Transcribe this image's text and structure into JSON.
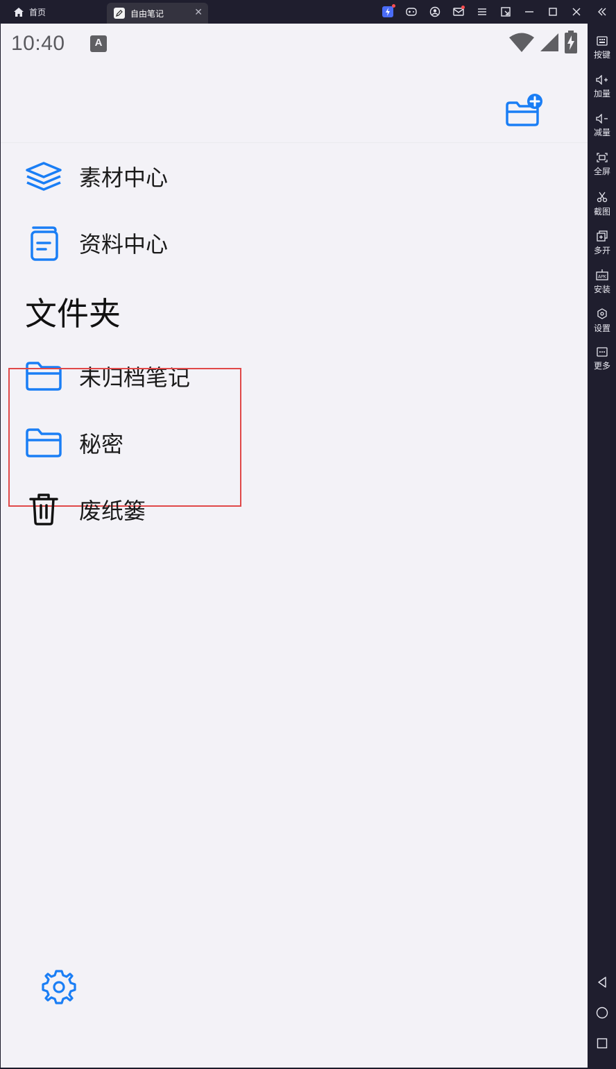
{
  "emulator": {
    "home_tab_label": "首页",
    "app_tab_label": "自由笔记",
    "sidebar": [
      {
        "label": "按键",
        "icon": "keyboard-icon"
      },
      {
        "label": "加量",
        "icon": "volume-up-icon"
      },
      {
        "label": "减量",
        "icon": "volume-down-icon"
      },
      {
        "label": "全屏",
        "icon": "fullscreen-icon"
      },
      {
        "label": "截图",
        "icon": "scissors-icon"
      },
      {
        "label": "多开",
        "icon": "multi-instance-icon"
      },
      {
        "label": "安装",
        "icon": "apk-install-icon"
      },
      {
        "label": "设置",
        "icon": "settings-hex-icon"
      },
      {
        "label": "更多",
        "icon": "more-icon"
      }
    ]
  },
  "status_bar": {
    "time": "10:40",
    "indicator": "A"
  },
  "menu": {
    "items": [
      {
        "label": "素材中心",
        "icon": "layers-icon"
      },
      {
        "label": "资料中心",
        "icon": "document-icon"
      }
    ],
    "folders_title": "文件夹",
    "folders": [
      {
        "label": "未归档笔记",
        "icon": "folder-icon"
      },
      {
        "label": "秘密",
        "icon": "folder-icon"
      }
    ],
    "trash": {
      "label": "废纸篓",
      "icon": "trash-icon"
    }
  },
  "colors": {
    "accent": "#1a7ef5",
    "background": "#f3f2f7",
    "highlight_border": "#e04848",
    "emulator_chrome": "#1f1e2e"
  }
}
